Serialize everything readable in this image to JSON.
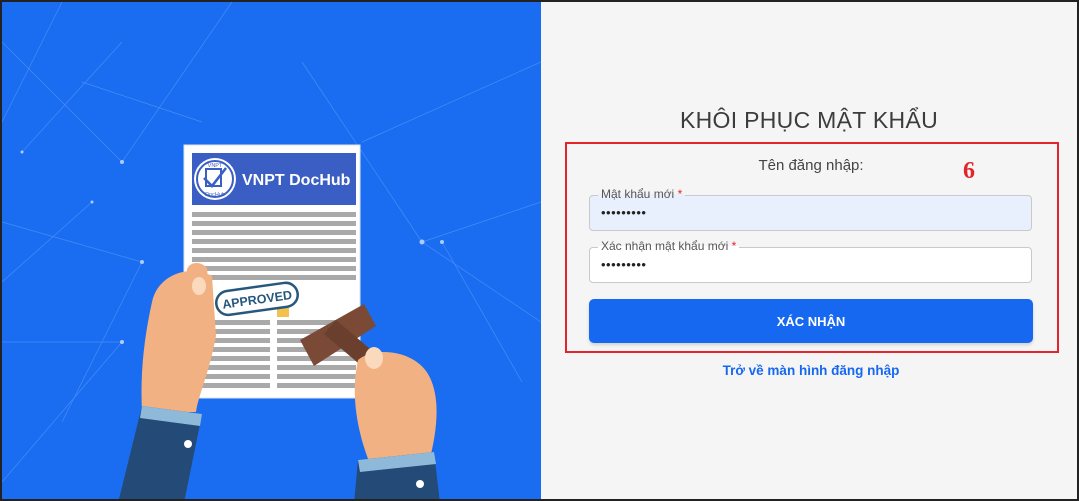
{
  "illustration": {
    "brand": "VNPT DocHub",
    "logo_small_top": "VNPT",
    "logo_small_bottom": "DocHub",
    "stamp": "APPROVED"
  },
  "form": {
    "title": "KHÔI PHỤC MẬT KHẨU",
    "username_label": "Tên đăng nhập:",
    "new_password": {
      "label": "Mật khẩu mới",
      "required_mark": "*",
      "value": "•••••••••"
    },
    "confirm_password": {
      "label": "Xác nhận mật khẩu mới",
      "required_mark": "*",
      "value": "•••••••••"
    },
    "submit_label": "XÁC NHẬN",
    "back_link": "Trở về màn hình đăng nhập",
    "annotation_number": "6"
  },
  "colors": {
    "left_background": "#1a6df0",
    "primary": "#1668f0",
    "annotation": "#e3242b"
  }
}
